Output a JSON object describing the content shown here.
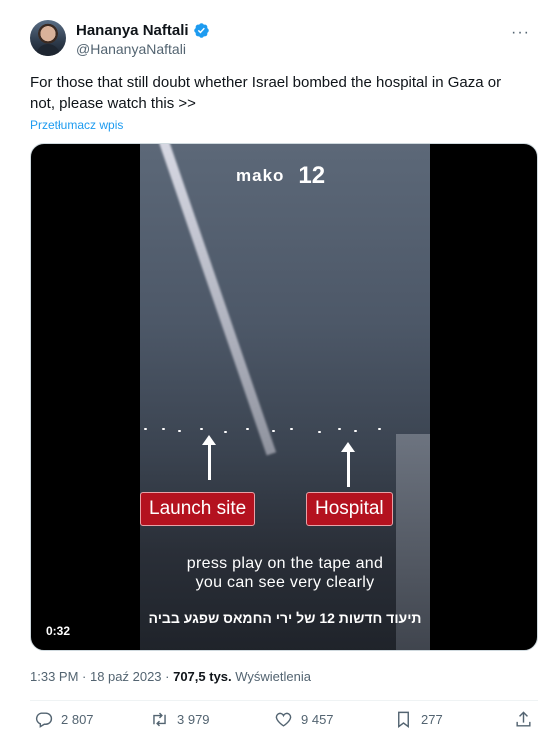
{
  "author": {
    "name": "Hananya Naftali",
    "handle": "@HananyaNaftali"
  },
  "tweet": {
    "text": "For those that still doubt whether Israel bombed the hospital in Gaza or not, please watch this >>",
    "translate_label": "Przetłumacz wpis"
  },
  "video": {
    "logo_text": "mako",
    "channel_number": "12",
    "label_left": "Launch site",
    "label_right": "Hospital",
    "caption_line1": "press play on the tape and",
    "caption_line2": "you can see very clearly",
    "hebrew_caption": "תיעוד חדשות 12 של ירי החמאס שפגע בביה",
    "duration": "0:32"
  },
  "meta": {
    "time": "1:33 PM · 18 paź 2023 · ",
    "views": "707,5 tys.",
    "views_label": " Wyświetlenia"
  },
  "actions": {
    "replies": "2 807",
    "retweets": "3 979",
    "likes": "9 457",
    "bookmarks": "277"
  },
  "colors": {
    "accent": "#1d9bf0",
    "label_red": "#b4121f"
  }
}
